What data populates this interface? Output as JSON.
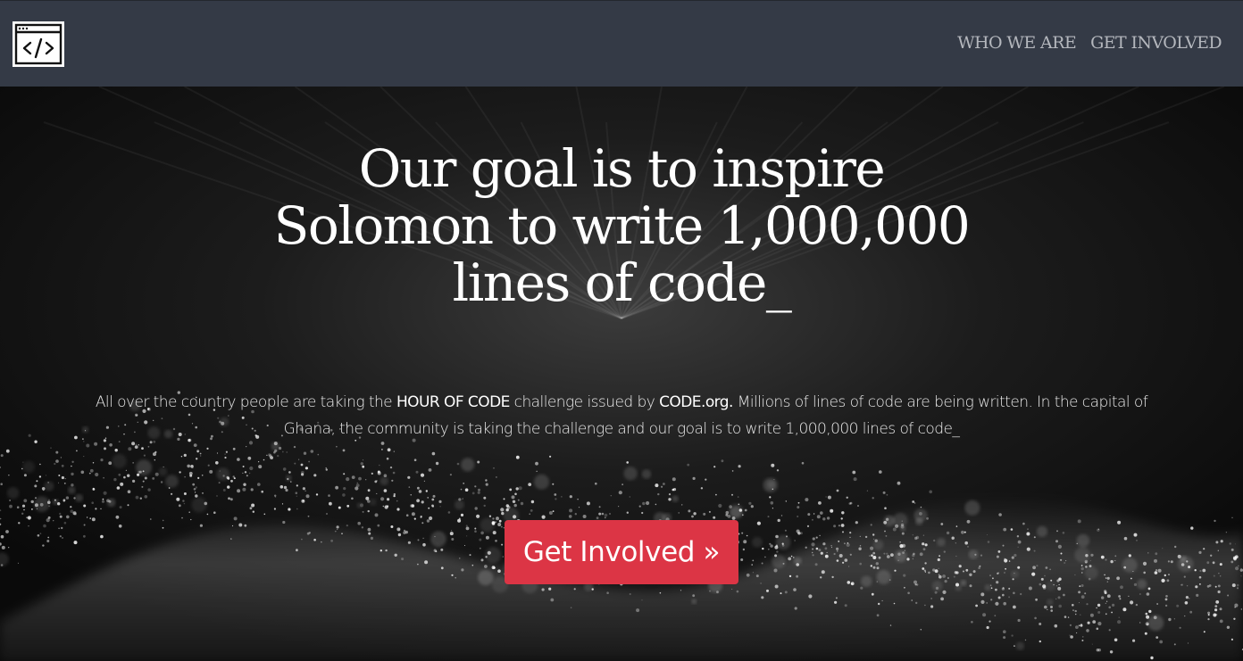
{
  "navbar": {
    "logo_icon": "code-window-icon",
    "links": [
      {
        "label": "WHO WE ARE"
      },
      {
        "label": "GET INVOLVED"
      }
    ]
  },
  "hero": {
    "headline_lines": [
      "Our goal is to inspire",
      "Solomon to write 1,000,000",
      "lines of code_"
    ],
    "lead": {
      "part1": "All over the country people are taking the ",
      "hour_of_code": "HOUR OF CODE",
      "part2": " challenge issued by ",
      "code_org": "CODE.org.",
      "part3": " Millions of lines of code are being written. In the capital of Ghana, the community is taking the challenge and our goal is to write 1,000,000 lines of code_"
    },
    "cta_label": "Get Involved »"
  },
  "colors": {
    "navbar_bg": "#343a46",
    "nav_link": "#b4b7bd",
    "hero_bg": "#121212",
    "cta_bg": "#dc3545",
    "text": "#ffffff"
  }
}
